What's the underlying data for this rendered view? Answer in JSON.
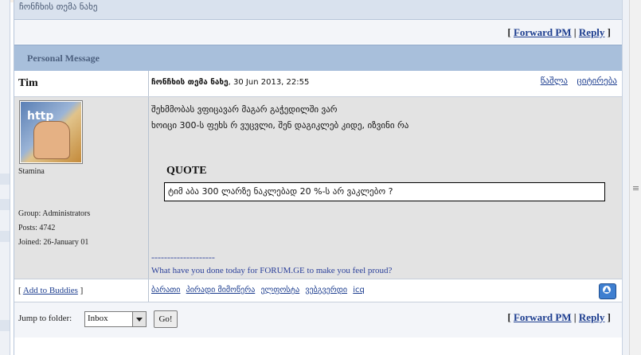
{
  "top_header": {
    "text": "ჩონჩხის თემა ნახე"
  },
  "forward_row": {
    "bracket_open": "[",
    "forward_label": "Forward PM",
    "sep": "|",
    "reply_label": "Reply",
    "bracket_close": "]"
  },
  "section_title": "Personal Message",
  "post": {
    "author": "Tim",
    "title_bold": "ჩონჩხის თემა ნახე",
    "date": ", 30 Jun 2013, 22:55",
    "delete_label": "წაშლა",
    "quote_label": "ციტირება",
    "rank": "Stamina",
    "group": "Group: Administrators",
    "posts": "Posts: 4742",
    "joined": "Joined: 26-January 01",
    "message_line1": "შეხმმობას ვფიცავარ მაგარ გაჭედილში ვარ",
    "message_line2": "ხოიცი 300-ს ფეხს რ ვუცვლი, შენ დაგიკლებ კიდე, იზვინი რა",
    "quote_heading": "QUOTE",
    "quote_text": "ტიმ აბა 300 ლარზე ნაკლებად 20 %-ს არ ვაკლებო ?",
    "signature_rule": "--------------------",
    "signature": "What have you done today for FORUM.GE to make you feel proud?",
    "add_buddies_label": "Add to Buddies",
    "profile_links": [
      "ბარათი",
      "პირადი მიმოწერა",
      "ელფოსტა",
      "ვებგვერდი",
      "icq"
    ]
  },
  "jump": {
    "label": "Jump to folder:",
    "selected": "Inbox",
    "go_label": "Go!"
  },
  "colors": {
    "section_bar": "#a8bfdb",
    "link": "#1c3d8f",
    "post_body": "#e3e3e3"
  }
}
